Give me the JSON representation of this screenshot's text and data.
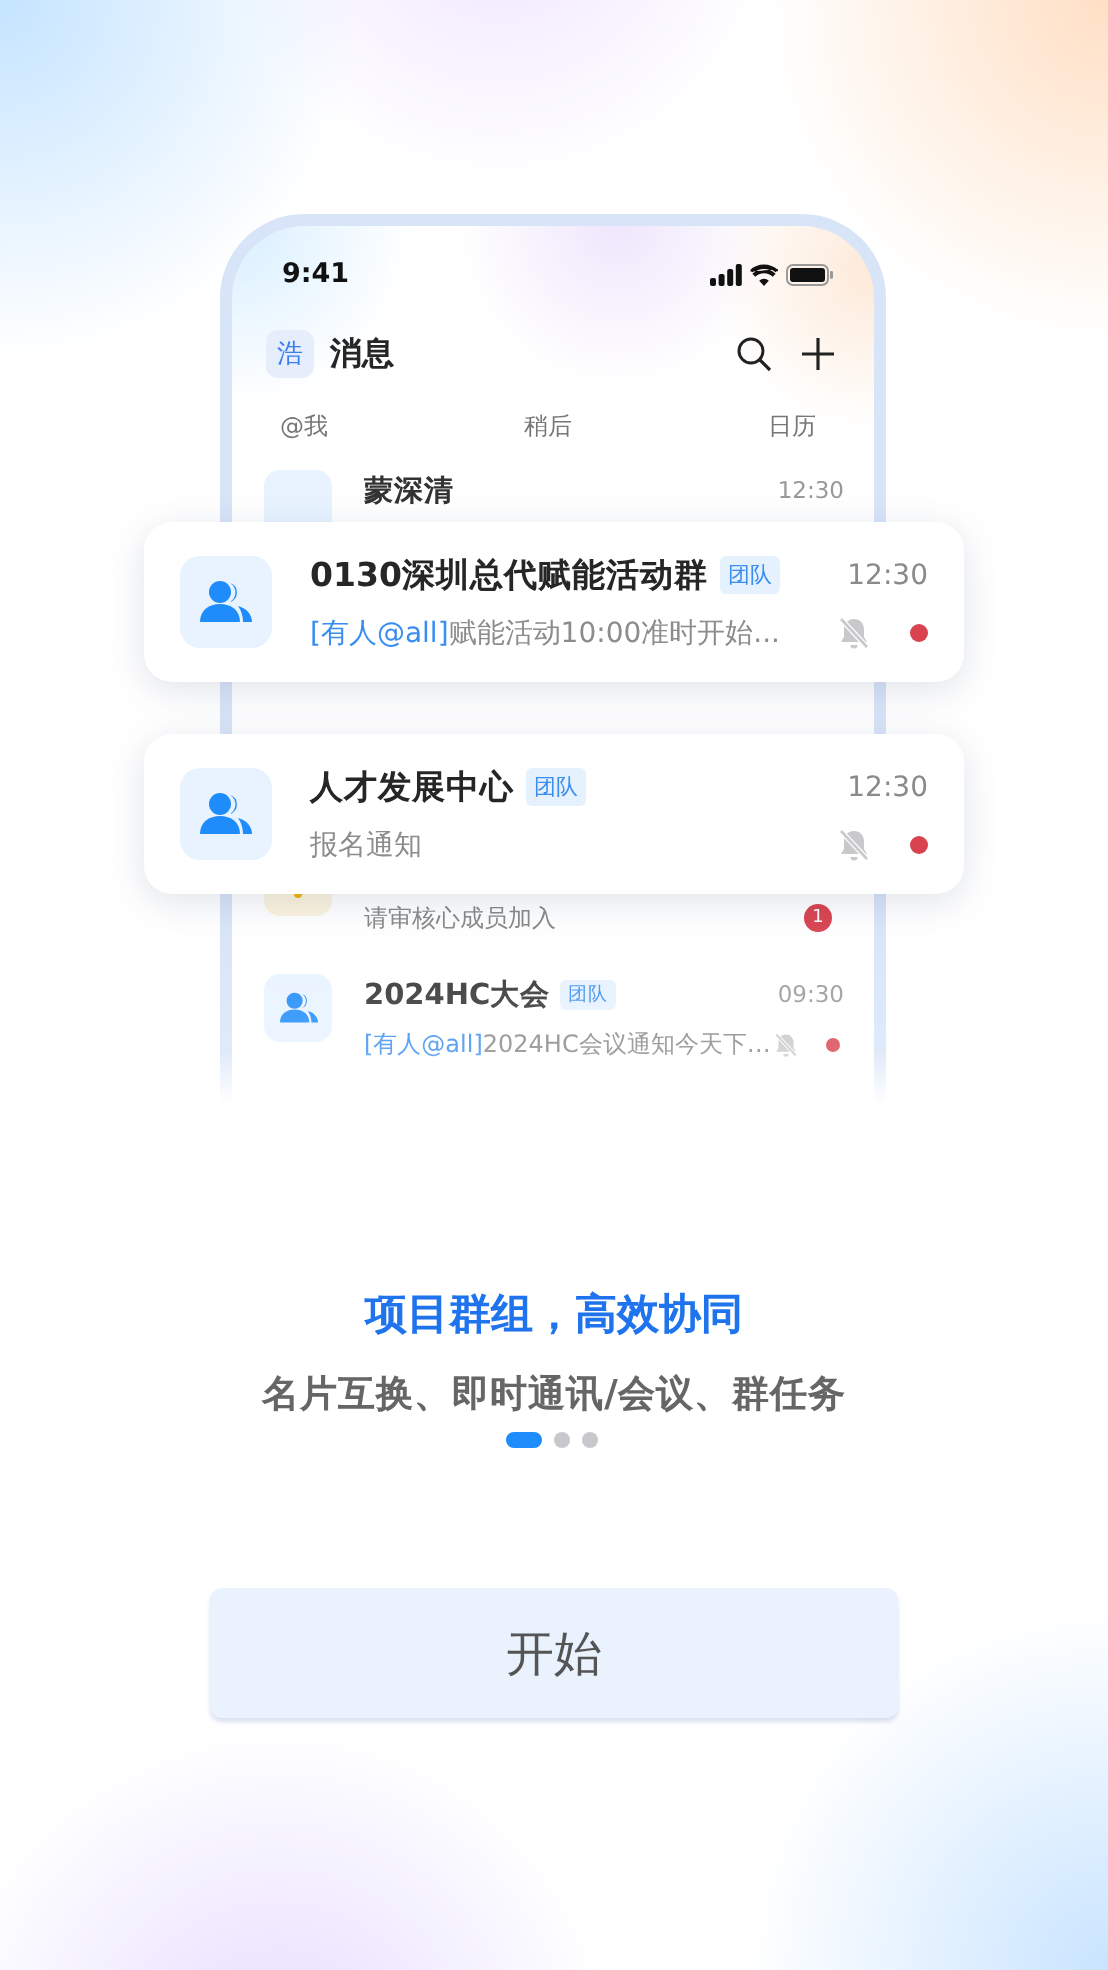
{
  "phone": {
    "status_time": "9:41",
    "header": {
      "avatar": "浩",
      "title": "消息"
    },
    "tabs": [
      {
        "label": "@我"
      },
      {
        "label": "稍后"
      },
      {
        "label": "日历"
      }
    ],
    "rows": [
      {
        "kind": "contact",
        "name": "蒙深清",
        "time": "12:30"
      },
      {
        "kind": "notice",
        "preview": "请审核心成员加入",
        "badge": "1"
      },
      {
        "kind": "group",
        "name": "2024HC大会",
        "tag": "团队",
        "time": "09:30",
        "mention": "[有人@all]",
        "preview": "2024HC会议通知今天下…",
        "muted": true,
        "unread": true
      }
    ]
  },
  "cards": [
    {
      "name": "0130深圳总代赋能活动群",
      "tag": "团队",
      "time": "12:30",
      "mention": "[有人@all]",
      "preview": "赋能活动10:00准时开始...",
      "muted": true,
      "unread": true
    },
    {
      "name": "人才发展中心",
      "tag": "团队",
      "time": "12:30",
      "preview": "报名通知",
      "muted": true,
      "unread": true
    }
  ],
  "headline": "项目群组，高效协同",
  "subtitle": "名片互换、即时通讯/会议、群任务",
  "pager": [
    {
      "selected": true
    },
    {
      "selected": false
    },
    {
      "selected": false
    }
  ],
  "start_button": "开始"
}
